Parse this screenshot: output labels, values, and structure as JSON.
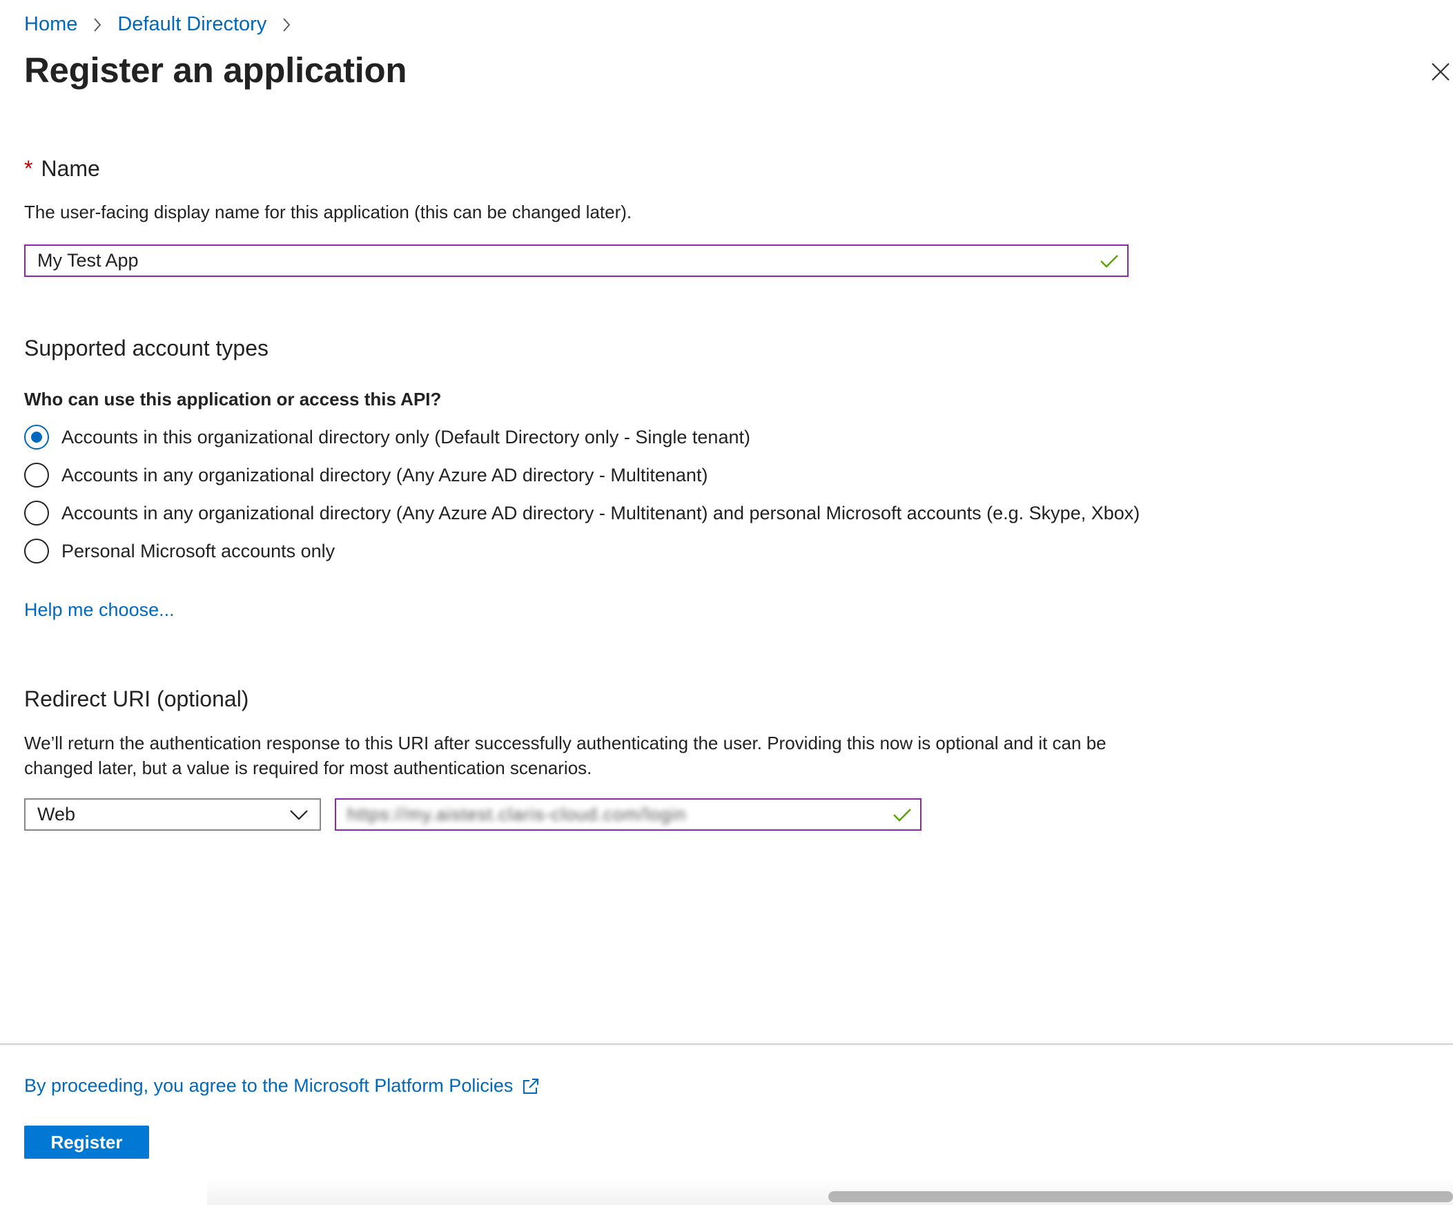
{
  "breadcrumb": {
    "items": [
      {
        "label": "Home"
      },
      {
        "label": "Default Directory"
      }
    ]
  },
  "page_title": "Register an application",
  "icons": {
    "close": "close-icon",
    "chevron_right": "chevron-right-icon",
    "chevron_down": "chevron-down-icon",
    "checkmark": "checkmark-icon",
    "external_link": "external-link-icon"
  },
  "colors": {
    "link": "#0068bd",
    "primary_button": "#0078d4",
    "field_border_active": "#8a2aa8",
    "valid_check": "#57a300",
    "required_star": "#c40000"
  },
  "name_section": {
    "required_marker": "*",
    "label": "Name",
    "description": "The user-facing display name for this application (this can be changed later).",
    "value": "My Test App"
  },
  "account_types": {
    "heading": "Supported account types",
    "question": "Who can use this application or access this API?",
    "options": [
      {
        "label": "Accounts in this organizational directory only (Default Directory only - Single tenant)",
        "checked": true
      },
      {
        "label": "Accounts in any organizational directory (Any Azure AD directory - Multitenant)",
        "checked": false
      },
      {
        "label": "Accounts in any organizational directory (Any Azure AD directory - Multitenant) and personal Microsoft accounts (e.g. Skype, Xbox)",
        "checked": false
      },
      {
        "label": "Personal Microsoft accounts only",
        "checked": false
      }
    ],
    "help_link": "Help me choose..."
  },
  "redirect": {
    "heading": "Redirect URI (optional)",
    "description": "We’ll return the authentication response to this URI after successfully authenticating the user. Providing this now is optional and it can be changed later, but a value is required for most authentication scenarios.",
    "platform_selected": "Web",
    "uri_value": "https://my.aistest.claris-cloud.com/login"
  },
  "footer": {
    "policy_link": "By proceeding, you agree to the Microsoft Platform Policies",
    "register_label": "Register"
  }
}
